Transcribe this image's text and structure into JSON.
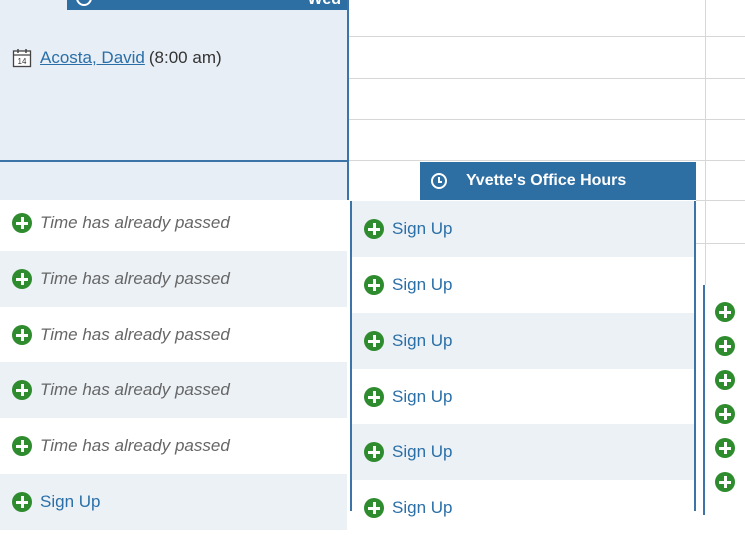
{
  "column1": {
    "day_label": "Wed",
    "appointment": {
      "calendar_day": "14",
      "name": "Acosta, David",
      "time": "(8:00 am)"
    },
    "rows": [
      {
        "text": "Time has already passed"
      },
      {
        "text": "Time has already passed"
      },
      {
        "text": "Time has already passed"
      },
      {
        "text": "Time has already passed"
      },
      {
        "text": "Time has already passed"
      },
      {
        "text": "Sign Up"
      }
    ]
  },
  "column2": {
    "header_title": "Yvette's Office Hours",
    "rows": [
      {
        "text": "Sign Up"
      },
      {
        "text": "Sign Up"
      },
      {
        "text": "Sign Up"
      },
      {
        "text": "Sign Up"
      },
      {
        "text": "Sign Up"
      },
      {
        "text": "Sign Up"
      }
    ]
  },
  "colors": {
    "header_blue": "#2d6ea3",
    "plus_green": "#2e8b2e",
    "link_blue": "#2a6fa7"
  }
}
